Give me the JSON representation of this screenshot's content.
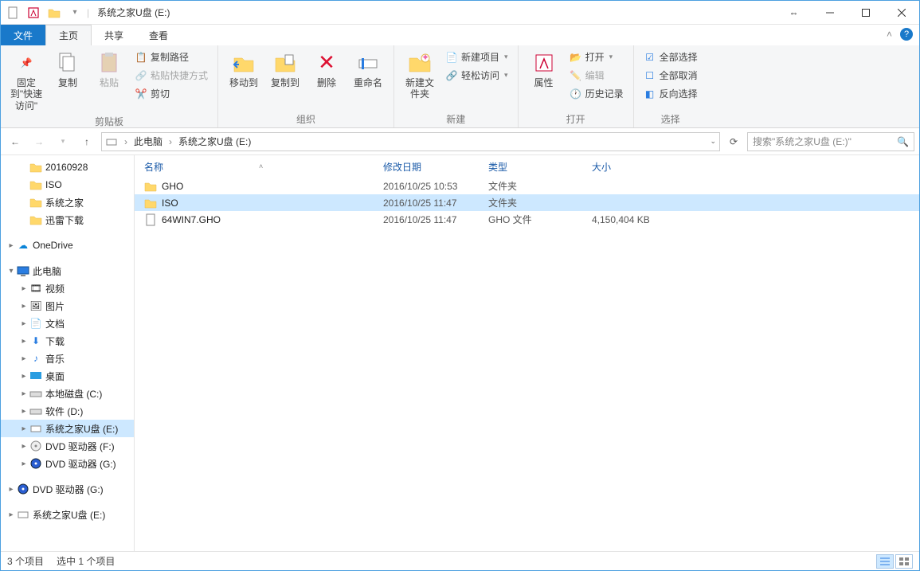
{
  "window": {
    "title": "系统之家U盘 (E:)"
  },
  "tabs": {
    "file": "文件",
    "home": "主页",
    "share": "共享",
    "view": "查看"
  },
  "ribbon": {
    "clipboard": {
      "label": "剪贴板",
      "pin": "固定到\"快速访问\"",
      "copy": "复制",
      "paste": "粘贴",
      "copypath": "复制路径",
      "pasteshortcut": "粘贴快捷方式",
      "cut": "剪切"
    },
    "organize": {
      "label": "组织",
      "moveto": "移动到",
      "copyto": "复制到",
      "delete": "删除",
      "rename": "重命名"
    },
    "new": {
      "label": "新建",
      "newfolder": "新建文件夹",
      "newitem": "新建项目",
      "easyaccess": "轻松访问"
    },
    "open": {
      "label": "打开",
      "properties": "属性",
      "open": "打开",
      "edit": "编辑",
      "history": "历史记录"
    },
    "select": {
      "label": "选择",
      "selectall": "全部选择",
      "selectnone": "全部取消",
      "invert": "反向选择"
    }
  },
  "breadcrumb": {
    "seg1": "此电脑",
    "seg2": "系统之家U盘 (E:)"
  },
  "search": {
    "placeholder": "搜索\"系统之家U盘 (E:)\""
  },
  "columns": {
    "name": "名称",
    "date": "修改日期",
    "type": "类型",
    "size": "大小"
  },
  "files": [
    {
      "name": "GHO",
      "date": "2016/10/25 10:53",
      "type": "文件夹",
      "size": "",
      "icon": "folder",
      "sel": false
    },
    {
      "name": "ISO",
      "date": "2016/10/25 11:47",
      "type": "文件夹",
      "size": "",
      "icon": "folder",
      "sel": true
    },
    {
      "name": "64WIN7.GHO",
      "date": "2016/10/25 11:47",
      "type": "GHO 文件",
      "size": "4,150,404 KB",
      "icon": "file",
      "sel": false
    }
  ],
  "tree": [
    {
      "label": "20160928",
      "indent": 36,
      "icon": "folder"
    },
    {
      "label": "ISO",
      "indent": 36,
      "icon": "folder"
    },
    {
      "label": "系统之家",
      "indent": 36,
      "icon": "folder"
    },
    {
      "label": "迅雷下载",
      "indent": 36,
      "icon": "folder"
    },
    {
      "spacer": true
    },
    {
      "label": "OneDrive",
      "indent": 20,
      "icon": "onedrive",
      "caret": "▸"
    },
    {
      "spacer": true
    },
    {
      "label": "此电脑",
      "indent": 20,
      "icon": "pc",
      "caret": "▾"
    },
    {
      "label": "视频",
      "indent": 36,
      "icon": "video",
      "caret": "▸"
    },
    {
      "label": "图片",
      "indent": 36,
      "icon": "pics",
      "caret": "▸"
    },
    {
      "label": "文档",
      "indent": 36,
      "icon": "docs",
      "caret": "▸"
    },
    {
      "label": "下载",
      "indent": 36,
      "icon": "down",
      "caret": "▸"
    },
    {
      "label": "音乐",
      "indent": 36,
      "icon": "music",
      "caret": "▸"
    },
    {
      "label": "桌面",
      "indent": 36,
      "icon": "desktop",
      "caret": "▸"
    },
    {
      "label": "本地磁盘 (C:)",
      "indent": 36,
      "icon": "disk",
      "caret": "▸"
    },
    {
      "label": "软件 (D:)",
      "indent": 36,
      "icon": "disk",
      "caret": "▸"
    },
    {
      "label": "系统之家U盘 (E:)",
      "indent": 36,
      "icon": "usb",
      "caret": "▸",
      "sel": true
    },
    {
      "label": "DVD 驱动器 (F:)",
      "indent": 36,
      "icon": "dvd",
      "caret": "▸"
    },
    {
      "label": "DVD 驱动器 (G:)",
      "indent": 36,
      "icon": "dvd2",
      "caret": "▸"
    },
    {
      "spacer": true
    },
    {
      "label": "DVD 驱动器 (G:)",
      "indent": 20,
      "icon": "dvd2",
      "caret": "▸"
    },
    {
      "spacer": true
    },
    {
      "label": "系统之家U盘 (E:)",
      "indent": 20,
      "icon": "usb",
      "caret": "▸"
    }
  ],
  "status": {
    "count": "3 个项目",
    "selected": "选中 1 个项目"
  }
}
